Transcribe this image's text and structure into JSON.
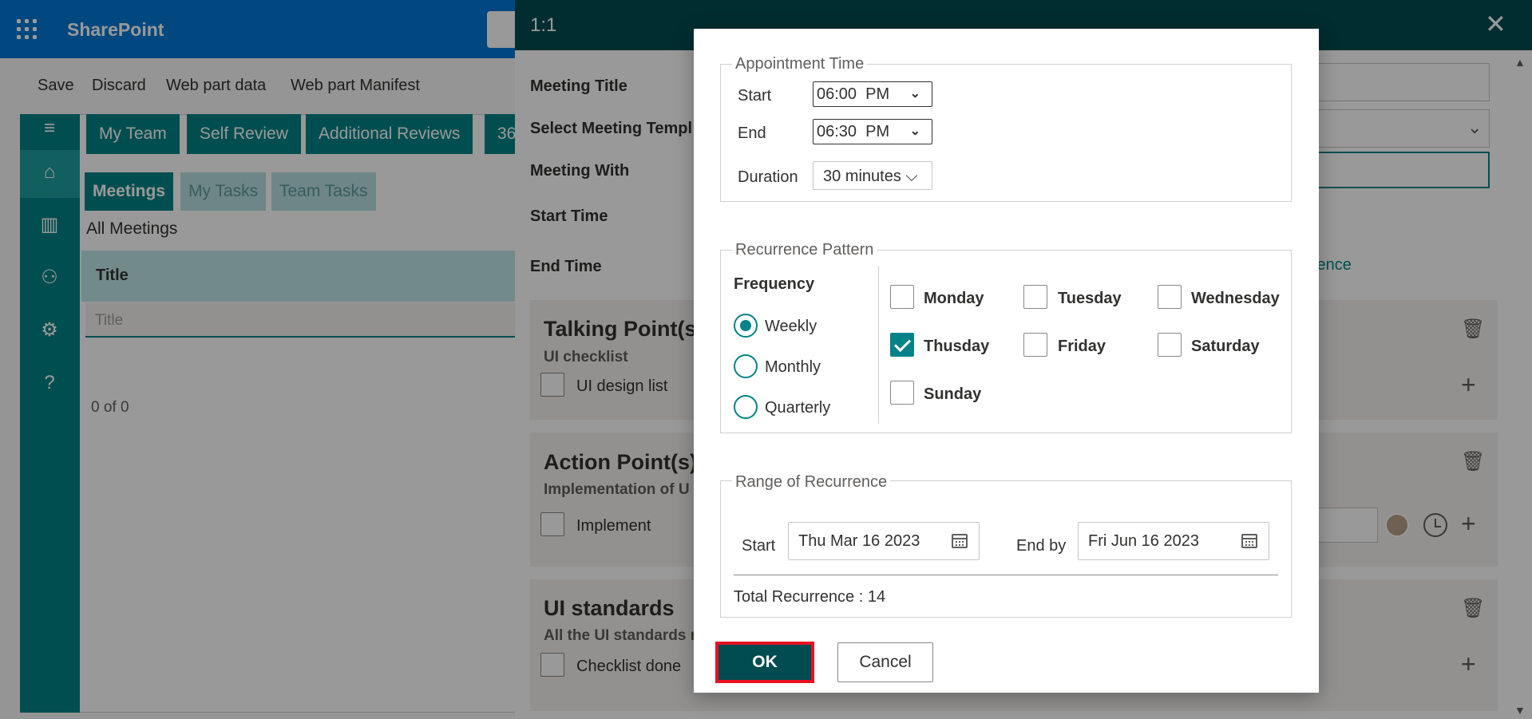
{
  "suite": {
    "title": "SharePoint"
  },
  "commands": {
    "save": "Save",
    "discard": "Discard",
    "webpart_data": "Web part data",
    "webpart_manifest": "Web part Manifest"
  },
  "top_tabs": [
    "My Team",
    "Self Review",
    "Additional Reviews",
    "36"
  ],
  "sub_tabs": [
    "Meetings",
    "My Tasks",
    "Team Tasks"
  ],
  "list": {
    "heading": "All Meetings",
    "column_title": "Title",
    "filter_placeholder": "Title",
    "paging": "0 of 0"
  },
  "panel": {
    "title": "1:1",
    "labels": {
      "meeting_title": "Meeting Title",
      "template": "Select Meeting Templ",
      "meeting_with": "Meeting With",
      "start_time": "Start Time",
      "end_time": "End Time"
    },
    "recurrence_link": "currence",
    "cards": [
      {
        "title": "Talking Point(s)",
        "subtitle": "UI checklist",
        "item": "UI design list"
      },
      {
        "title": "Action Point(s)",
        "subtitle": "Implementation of U",
        "item": "Implement"
      },
      {
        "title": "UI standards",
        "subtitle": "All the UI standards r",
        "item": "Checklist done"
      }
    ]
  },
  "dialog": {
    "appointment": {
      "legend": "Appointment Time",
      "start_label": "Start",
      "start_value": "06:00  PM",
      "end_label": "End",
      "end_value": "06:30  PM",
      "duration_label": "Duration",
      "duration_value": "30 minutes"
    },
    "pattern": {
      "legend": "Recurrence Pattern",
      "frequency_label": "Frequency",
      "options": [
        "Weekly",
        "Monthly",
        "Quarterly"
      ],
      "selected": "Weekly",
      "days": [
        "Monday",
        "Tuesday",
        "Wednesday",
        "Thusday",
        "Friday",
        "Saturday",
        "Sunday"
      ],
      "checked_days": [
        "Thusday"
      ]
    },
    "range": {
      "legend": "Range of Recurrence",
      "start_label": "Start",
      "start_value": "Thu Mar 16 2023",
      "end_label": "End by",
      "end_value": "Fri Jun 16 2023",
      "total": "Total Recurrence : 14"
    },
    "ok_label": "OK",
    "cancel_label": "Cancel"
  },
  "colors": {
    "brand": "#0078d4",
    "teal": "#038387",
    "dark_teal": "#004c50",
    "highlight_border": "#e81123"
  }
}
